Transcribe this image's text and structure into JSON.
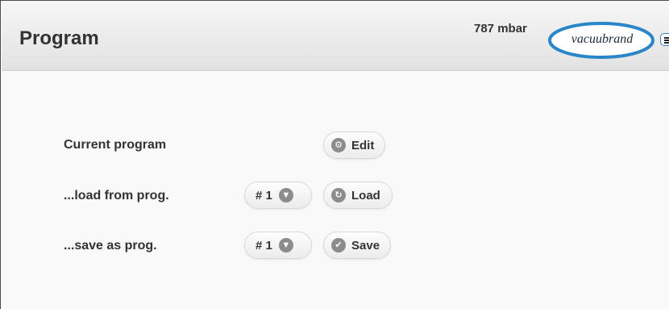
{
  "header": {
    "title": "Program",
    "pressure": "787 mbar",
    "logo_text": "vacuubrand"
  },
  "rows": [
    {
      "label": "Current program",
      "button": {
        "label": "Edit",
        "icon": "gear-icon"
      }
    },
    {
      "label": "...load from prog.",
      "select": {
        "value": "# 1",
        "icon": "chevron-down-icon"
      },
      "button": {
        "label": "Load",
        "icon": "refresh-icon"
      }
    },
    {
      "label": "...save as prog.",
      "select": {
        "value": "# 1",
        "icon": "chevron-down-icon"
      },
      "button": {
        "label": "Save",
        "icon": "check-icon"
      }
    }
  ],
  "colors": {
    "header_bg": "#e8e8e8",
    "logo_ellipse": "#2a86c8",
    "icon_gray": "#8c8c8c"
  }
}
